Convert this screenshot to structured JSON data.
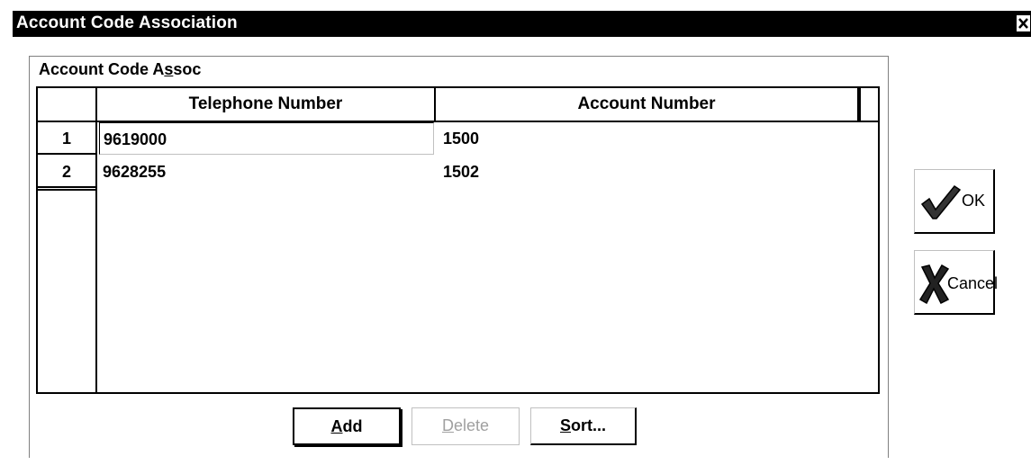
{
  "window": {
    "title": "Account Code Association",
    "close_icon": "close-icon"
  },
  "group": {
    "label": "Account Code Assoc",
    "label_prefix": "Account Code A",
    "label_underlined": "s",
    "label_suffix": "soc"
  },
  "grid": {
    "columns": [
      "Telephone Number",
      "Account Number"
    ],
    "rows": [
      {
        "num": "1",
        "telephone": "9619000",
        "account": "1500"
      },
      {
        "num": "2",
        "telephone": "9628255",
        "account": "1502"
      }
    ]
  },
  "buttons": {
    "add": {
      "label": "Add",
      "underlined": "A",
      "rest": "dd"
    },
    "delete": {
      "label": "Delete",
      "underlined": "D",
      "rest": "elete",
      "enabled": false
    },
    "sort": {
      "label": "Sort...",
      "underlined": "S",
      "rest": "ort..."
    },
    "ok": {
      "label": "OK",
      "icon": "checkmark-icon"
    },
    "cancel": {
      "label": "Cancel",
      "icon": "x-icon"
    }
  }
}
